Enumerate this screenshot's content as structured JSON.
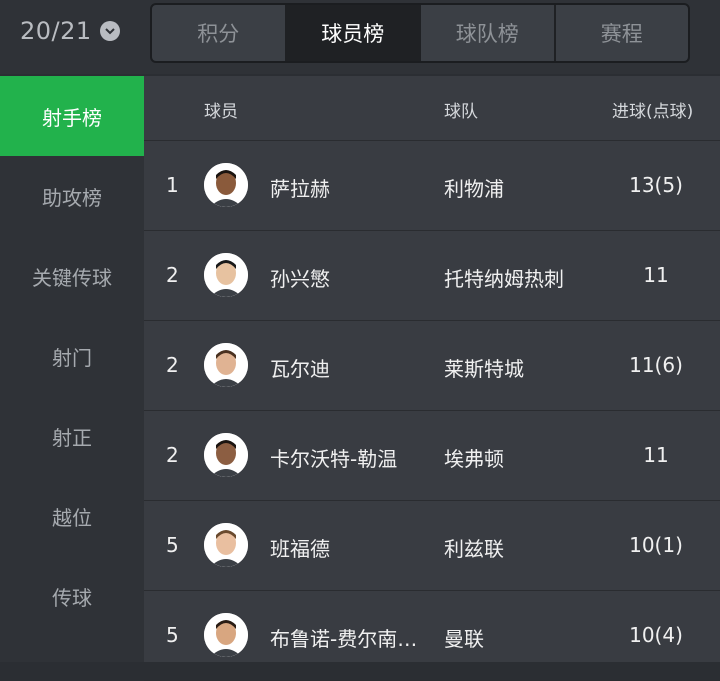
{
  "season": {
    "label": "20/21"
  },
  "tabs": [
    {
      "label": "积分"
    },
    {
      "label": "球员榜"
    },
    {
      "label": "球队榜"
    },
    {
      "label": "赛程"
    }
  ],
  "sidebar": {
    "items": [
      {
        "label": "射手榜"
      },
      {
        "label": "助攻榜"
      },
      {
        "label": "关键传球"
      },
      {
        "label": "射门"
      },
      {
        "label": "射正"
      },
      {
        "label": "越位"
      },
      {
        "label": "传球"
      }
    ]
  },
  "table": {
    "headers": {
      "player": "球员",
      "team": "球队",
      "goals": "进球(点球)"
    },
    "rows": [
      {
        "rank": "1",
        "player": "萨拉赫",
        "team": "利物浦",
        "goals": "13(5)",
        "skin": "#8a5a3b",
        "hair": "#1b1410"
      },
      {
        "rank": "2",
        "player": "孙兴慜",
        "team": "托特纳姆热刺",
        "goals": "11",
        "skin": "#e7c2a0",
        "hair": "#1a1a1a"
      },
      {
        "rank": "2",
        "player": "瓦尔迪",
        "team": "莱斯特城",
        "goals": "11(6)",
        "skin": "#e0b393",
        "hair": "#4a3120"
      },
      {
        "rank": "2",
        "player": "卡尔沃特-勒温",
        "team": "埃弗顿",
        "goals": "11",
        "skin": "#8c5e42",
        "hair": "#1b1410"
      },
      {
        "rank": "5",
        "player": "班福德",
        "team": "利兹联",
        "goals": "10(1)",
        "skin": "#e9bfa0",
        "hair": "#6a4a2e"
      },
      {
        "rank": "5",
        "player": "布鲁诺-费尔南…",
        "team": "曼联",
        "goals": "10(4)",
        "skin": "#d8a680",
        "hair": "#2a1c14"
      }
    ]
  },
  "colors": {
    "accent": "#22b24c",
    "background": "#393c42",
    "sidebar": "#2f3237"
  },
  "icons": {
    "season_dropdown": "chevron-down-icon"
  }
}
